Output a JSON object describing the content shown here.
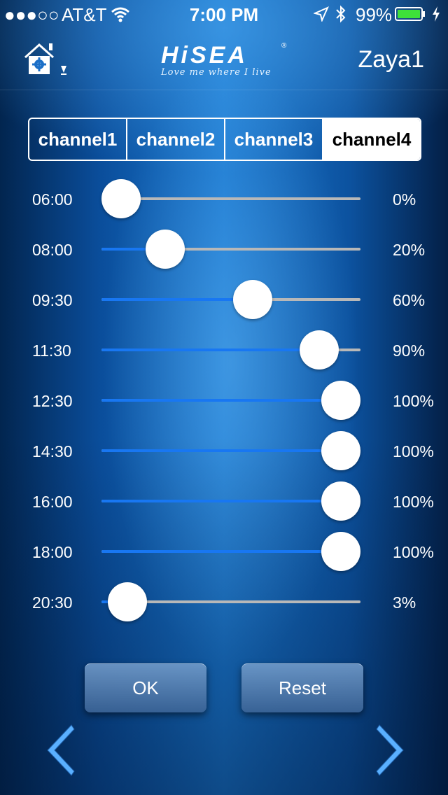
{
  "status_bar": {
    "signal": "●●●○○",
    "carrier": "AT&T",
    "time": "7:00 PM",
    "battery_percent": "99%",
    "icons": [
      "wifi-icon",
      "location-arrow-icon",
      "bluetooth-icon",
      "battery-icon",
      "charging-bolt-icon"
    ]
  },
  "header": {
    "logo_text": "HiSEA",
    "logo_registered": "®",
    "logo_tagline": "Love me where I live",
    "user_name": "Zaya1",
    "home_icon": "home-gear-icon"
  },
  "tabs": [
    {
      "label": "channel1",
      "active": false
    },
    {
      "label": "channel2",
      "active": false
    },
    {
      "label": "channel3",
      "active": false
    },
    {
      "label": "channel4",
      "active": true
    }
  ],
  "schedule": [
    {
      "time": "06:00",
      "percent": "0%",
      "value": 0
    },
    {
      "time": "08:00",
      "percent": "20%",
      "value": 20
    },
    {
      "time": "09:30",
      "percent": "60%",
      "value": 60
    },
    {
      "time": "11:30",
      "percent": "90%",
      "value": 90
    },
    {
      "time": "12:30",
      "percent": "100%",
      "value": 100
    },
    {
      "time": "14:30",
      "percent": "100%",
      "value": 100
    },
    {
      "time": "16:00",
      "percent": "100%",
      "value": 100
    },
    {
      "time": "18:00",
      "percent": "100%",
      "value": 100
    },
    {
      "time": "20:30",
      "percent": "3%",
      "value": 3
    }
  ],
  "buttons": {
    "ok": "OK",
    "reset": "Reset"
  },
  "colors": {
    "slider_fill": "#1877f2",
    "slider_track": "#b8b8b8",
    "accent": "#ffffff"
  }
}
